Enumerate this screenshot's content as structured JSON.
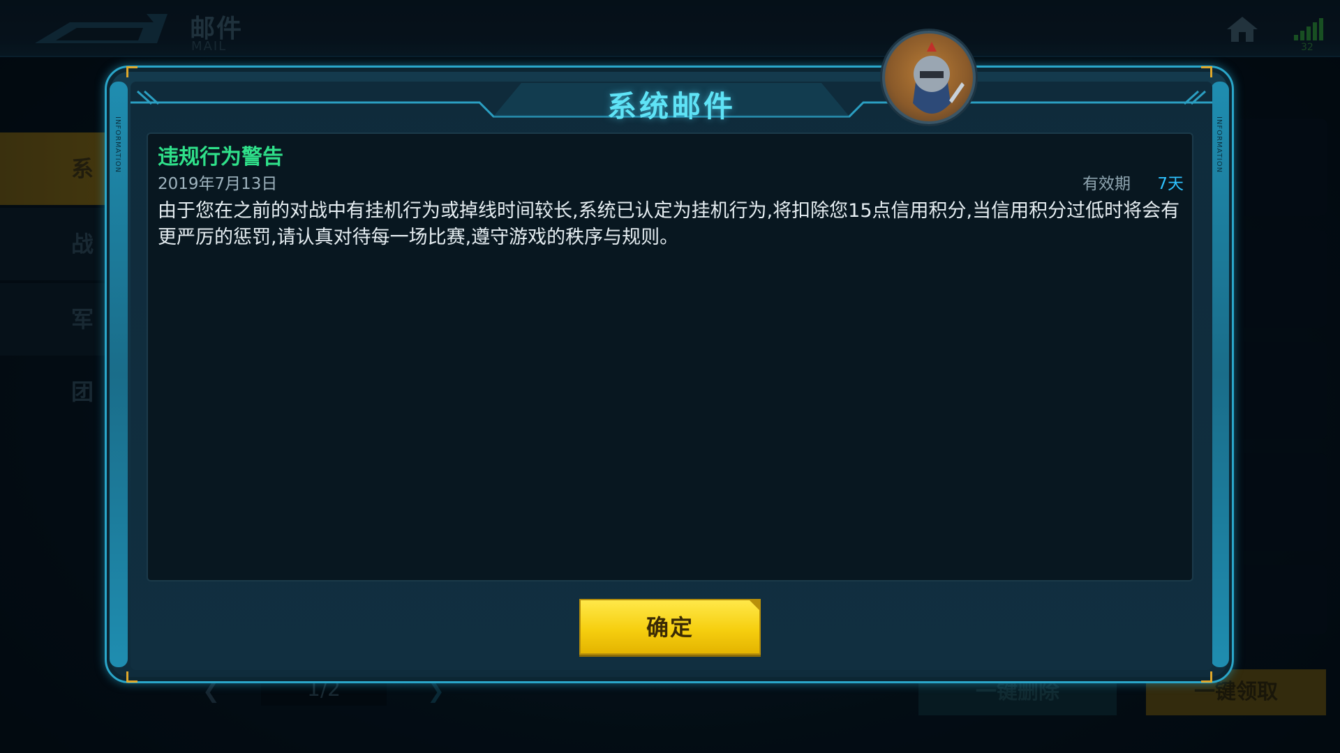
{
  "topbar": {
    "title": "邮件",
    "subtitle": "MAIL",
    "signal_value": "32"
  },
  "sidebar": {
    "items": [
      {
        "label": "系统"
      },
      {
        "label": "战报"
      },
      {
        "label": "军团"
      }
    ]
  },
  "pager": {
    "text": "1/2"
  },
  "actions": {
    "delete_all": "一键删除",
    "claim_all": "一键领取"
  },
  "modal": {
    "title": "系统邮件",
    "side_text": "INFORMATION",
    "subject": "违规行为警告",
    "date": "2019年7月13日",
    "expiry_label": "有效期",
    "expiry_value": "7天",
    "body": "由于您在之前的对战中有挂机行为或掉线时间较长,系统已认定为挂机行为,将扣除您15点信用积分,当信用积分过低时将会有更严厉的惩罚,请认真对待每一场比赛,遵守游戏的秩序与规则。",
    "confirm_label": "确定"
  },
  "colors": {
    "accent": "#5fe3f6",
    "subject": "#2fe08a",
    "expiry": "#2ec2ff",
    "button": "#f6cf10"
  },
  "icons": {
    "back": "back-arrow-icon",
    "home": "home-icon",
    "signal": "signal-icon",
    "avatar": "knight-avatar"
  }
}
